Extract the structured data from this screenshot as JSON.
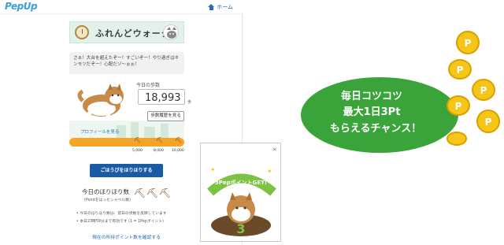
{
  "app": {
    "logo_text": "PepUp",
    "home_label": "ホーム"
  },
  "banner": {
    "title": "ふれんどウォーク"
  },
  "speech": {
    "text": "さぁ！大台を超えたぞー！すごいぞー！やり過ぎはキンモツだぞー！心配だゾ〜ぉぉ！"
  },
  "steps": {
    "label": "今日の歩数",
    "value": "18,993",
    "unit": "歩",
    "history_button": "歩数履歴を見る"
  },
  "profile": {
    "link_label": "プロフィールを見る"
  },
  "progress": {
    "ticks": [
      "5,000",
      "8,000",
      "10,000"
    ]
  },
  "dig": {
    "button_label": "ごほうびをほりほりする",
    "count_title": "今日のほりほり数",
    "count_sub": "(Pointをほったシャベル数)"
  },
  "notes": [
    "今日のほりほり数は、前日の歩数を反映しています",
    "本日23時59分まで有効です (1 = 1Pepポイント)"
  ],
  "points_link": "現在の所持ポイント数を確認する",
  "popup": {
    "close_label": "×",
    "badge_text": "3PepポイントGET!",
    "number": "3"
  },
  "promo": {
    "line1": "毎日コツコツ",
    "line2": "最大1日3Pt",
    "line3": "もらえるチャンス！"
  },
  "colors": {
    "accent": "#1b5aa4",
    "orange": "#f6a428",
    "green": "#3aa43a",
    "gold": "#f5c518"
  }
}
